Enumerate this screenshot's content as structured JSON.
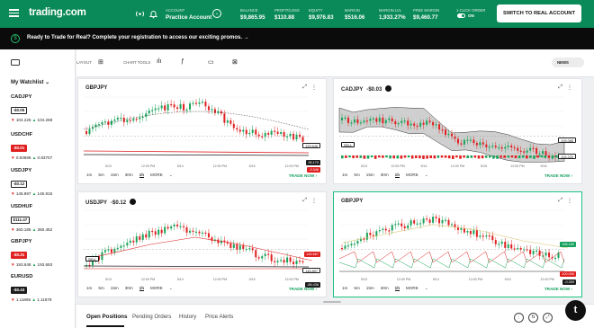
{
  "header": {
    "logo": "trading.com",
    "account_label": "ACCOUNT",
    "account_value": "Practice Account",
    "stats": [
      {
        "label": "BALANCE",
        "value": "$9,865.95"
      },
      {
        "label": "PROFIT/LOSS",
        "value": "$110.88"
      },
      {
        "label": "EQUITY",
        "value": "$9,976.83"
      },
      {
        "label": "MARGIN",
        "value": "$516.06"
      },
      {
        "label": "MARGIN LVL",
        "value": "1,933.27%"
      },
      {
        "label": "FREE MARGIN",
        "value": "$9,460.77"
      },
      {
        "label": "1-CLICK ORDER",
        "value": "ON"
      }
    ],
    "switch_button": "SWITCH TO REAL ACCOUNT"
  },
  "banner": {
    "message": "Ready to Trade for Real? Complete your registration to access our exciting promos.",
    "arrow": "→"
  },
  "sidebar": {
    "title": "My Watchlist",
    "items": [
      {
        "symbol": "CADJPY",
        "change": "-$0.05",
        "style": "neu",
        "bid_arrow": "▼",
        "bid": "104.225",
        "ask_arrow": "▲",
        "ask": "104.268"
      },
      {
        "symbol": "USDCHF",
        "change": "-$0.01",
        "style": "neg",
        "bid_arrow": "▼",
        "bid": "0.83686",
        "ask_arrow": "▲",
        "ask": "0.83707"
      },
      {
        "symbol": "USDJPY",
        "change": "-$0.12",
        "style": "neu",
        "bid_arrow": "▼",
        "bid": "145.897",
        "ask_arrow": "▲",
        "ask": "145.915"
      },
      {
        "symbol": "USDHUF",
        "change": "$111.47",
        "style": "neu",
        "bid_arrow": "▼",
        "bid": "360.185",
        "ask_arrow": "▲",
        "ask": "360.452"
      },
      {
        "symbol": "GBPJPY",
        "change": "-$0.31",
        "style": "neg",
        "bid_arrow": "▼",
        "bid": "193.648",
        "ask_arrow": "▲",
        "ask": "193.693"
      },
      {
        "symbol": "EURUSD",
        "change": "-$0.43",
        "style": "dark",
        "bid_arrow": "▼",
        "bid": "1.11865",
        "ask_arrow": "▲",
        "ask": "1.11878"
      }
    ]
  },
  "toolbar": {
    "layout_label": "LAYOUT",
    "chart_tools_label": "CHART TOOLS",
    "news_label": "NEWS"
  },
  "charts": [
    {
      "symbol": "GBPJPY",
      "change": "",
      "has_close": false,
      "dates": [
        "5/13",
        "12:00 PM",
        "5/14",
        "12:00 PM",
        "5/15",
        "12:00 PM"
      ],
      "price_tags": [
        {
          "text": "193.648",
          "color": "#1d1d1d",
          "outline": true
        },
        {
          "text": "35.170",
          "color": "#1d1d1d",
          "outline": false
        },
        {
          "text": "-3.346",
          "color": "#e02020",
          "outline": false
        }
      ],
      "sell_tag": ""
    },
    {
      "symbol": "CADJPY",
      "change": "-$0.03",
      "has_close": true,
      "dates": [
        "5/13",
        "12:00 PM",
        "5/14",
        "12:00 PM",
        "5/15",
        "12:00 PM",
        "5/16"
      ],
      "price_tags": [
        {
          "text": "105.088",
          "color": "#1d1d1d",
          "outline": true
        },
        {
          "text": "104.225",
          "color": "#1d1d1d",
          "outline": true
        }
      ],
      "sell_tag": "SELL"
    },
    {
      "symbol": "USDJPY",
      "change": "-$0.12",
      "has_close": true,
      "dates": [
        "5/13",
        "12:00 PM",
        "5/14",
        "12:00 PM",
        "5/15",
        "12:00 PM"
      ],
      "price_tags": [
        {
          "text": "146.667",
          "color": "#e02020",
          "outline": false
        },
        {
          "text": "145.897",
          "color": "#1d1d1d",
          "outline": true
        },
        {
          "text": "-86.436",
          "color": "#1d1d1d",
          "outline": false
        }
      ],
      "sell_tag": "SELL"
    },
    {
      "symbol": "GBPJPY",
      "change": "",
      "has_close": false,
      "dates": [
        "5/13",
        "12:00 PM",
        "5/14",
        "12:00 PM",
        "5/15",
        "12:00 PM"
      ],
      "price_tags": [
        {
          "text": "196.160",
          "color": "#14a05d",
          "outline": false
        },
        {
          "text": "100.000",
          "color": "#e02020",
          "outline": false
        },
        {
          "text": "-0.359",
          "color": "#1d1d1d",
          "outline": false
        }
      ],
      "sell_tag": ""
    }
  ],
  "timeframes": [
    "1m",
    "5m",
    "15m",
    "30m",
    "1h",
    "MORE"
  ],
  "active_timeframe": "1h",
  "trade_now": "TRADE NOW ›",
  "bottom_tabs": [
    "Open Positions",
    "Pending Orders",
    "History",
    "Price Alerts"
  ],
  "colors": {
    "brand": "#0a8a58",
    "up": "#19a35a",
    "down": "#e02020",
    "selected_border": "#1cc283"
  }
}
